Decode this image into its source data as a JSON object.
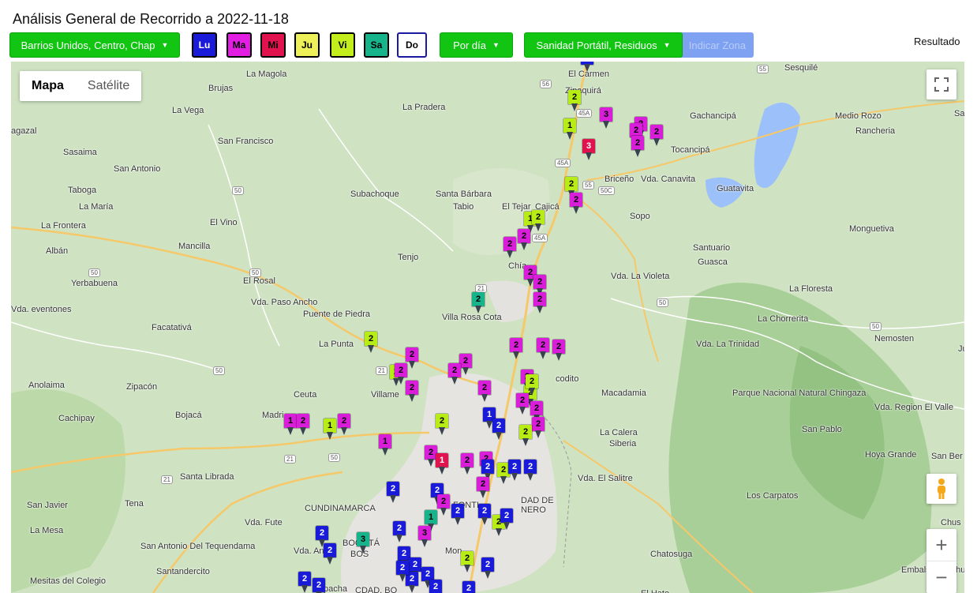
{
  "page_title": "Análisis General de Recorrido a 2022-11-18",
  "toolbar": {
    "barrios_select": "Barrios Unidos, Centro, Chap",
    "days": [
      {
        "label": "Lu",
        "color": "#1a1ad9"
      },
      {
        "label": "Ma",
        "color": "#e31ee3"
      },
      {
        "label": "Mi",
        "color": "#e0134f"
      },
      {
        "label": "Ju",
        "color": "#eef05a"
      },
      {
        "label": "Vi",
        "color": "#c3ee1b"
      },
      {
        "label": "Sa",
        "color": "#17b38a"
      },
      {
        "label": "Do",
        "color": "#ffffff"
      }
    ],
    "period_select": "Por día",
    "service_select": "Sanidad Portátil, Residuos",
    "indicar_zona": "Indicar Zona",
    "resultado": "Resultado"
  },
  "map": {
    "type_buttons": {
      "mapa": "Mapa",
      "satelite": "Satélite"
    },
    "fullscreen_icon": "fullscreen-icon",
    "pegman_icon": "pegman-icon",
    "zoom_in": "+",
    "zoom_out": "−",
    "marker_colors": {
      "lu": "#1a1ad9",
      "ma": "#d81ed8",
      "mi": "#e0134f",
      "ju": "#e8ef56",
      "vi": "#b7ec16",
      "sa": "#17b38a"
    },
    "places": [
      "La Magola",
      "Brujas",
      "El Carmen",
      "Zipaquirá",
      "Sesquilé",
      "La Pradera",
      "La Vega",
      "Gachancipá",
      "Medio Rozo",
      "Rancheria",
      "Sant",
      "agazal",
      "San Francisco",
      "Tocancipá",
      "Sasaima",
      "San Antonio",
      "Briceño",
      "Vda. Canavita",
      "Guatavita",
      "Taboga",
      "Subachoque",
      "Santa Bárbara",
      "Tabio",
      "El Tejar",
      "Cajicá",
      "La María",
      "Sopo",
      "La Frontera",
      "El Vino",
      "Monguetiva",
      "Mancilla",
      "Albán",
      "Santuario",
      "Guasca",
      "Tenjo",
      "Chía",
      "Yerbabuena",
      "El Rosal",
      "Vda. La Violeta",
      "La Floresta",
      "Vda. Paso Ancho",
      "Puente de Piedra",
      "Vda. eventones",
      "Villa Rosa Cota",
      "La Chorrerita",
      "Facatativá",
      "Nemosten",
      "Vda. La Trinidad",
      "Juni",
      "La Punta",
      "Anolaima",
      "Zipacón",
      "Villame",
      "codito",
      "Macadamia",
      "Parque Nacional Natural Chingaza",
      "Vda. Region El Valle",
      "Cachipay",
      "Bojacá",
      "Madri",
      "Ceuta",
      "San Pablo",
      "La Calera",
      "Siberia",
      "Hoya Grande",
      "San Ber",
      "Santa Librada",
      "Vda. El Salitre",
      "CUNDINAMARCA",
      "FONTI",
      "DAD DE",
      "NERO",
      "San Javier",
      "Tena",
      "Los Carpatos",
      "La Mesa",
      "Vda. Fute",
      "San Antonio Del Tequendama",
      "Vda. Anc",
      "BOGOTÁ",
      "BOS",
      "Mon",
      "Chatosuga",
      "Chus",
      "Santandercito",
      "Mesitas del Colegio",
      "pacha",
      "CDAD. BO",
      "Embalse de Chuz",
      "El Hato"
    ],
    "routes": [
      "56",
      "55",
      "45A",
      "45A",
      "55",
      "50C",
      "50",
      "50",
      "45A",
      "50",
      "21",
      "50",
      "50",
      "50",
      "21",
      "50",
      "21",
      "21"
    ],
    "markers": [
      {
        "n": "2",
        "c": "lu"
      },
      {
        "n": "2",
        "c": "vi"
      },
      {
        "n": "3",
        "c": "ma"
      },
      {
        "n": "2",
        "c": "ma"
      },
      {
        "n": "2",
        "c": "ma"
      },
      {
        "n": "2",
        "c": "ma"
      },
      {
        "n": "1",
        "c": "vi"
      },
      {
        "n": "3",
        "c": "mi"
      },
      {
        "n": "2",
        "c": "ma"
      },
      {
        "n": "2",
        "c": "vi"
      },
      {
        "n": "2",
        "c": "ma"
      },
      {
        "n": "1",
        "c": "vi"
      },
      {
        "n": "2",
        "c": "ma"
      },
      {
        "n": "2",
        "c": "vi"
      },
      {
        "n": "2",
        "c": "ma"
      },
      {
        "n": "2",
        "c": "ma"
      },
      {
        "n": "2",
        "c": "ma"
      },
      {
        "n": "2",
        "c": "ma"
      },
      {
        "n": "2",
        "c": "sa"
      },
      {
        "n": "2",
        "c": "vi"
      },
      {
        "n": "2",
        "c": "ma"
      },
      {
        "n": "2",
        "c": "ma"
      },
      {
        "n": "2",
        "c": "ma"
      },
      {
        "n": "2",
        "c": "ma"
      },
      {
        "n": "2",
        "c": "vi"
      },
      {
        "n": "2",
        "c": "ma"
      },
      {
        "n": "2",
        "c": "ma"
      },
      {
        "n": "2",
        "c": "ma"
      },
      {
        "n": "2",
        "c": "ma"
      },
      {
        "n": "2",
        "c": "vi"
      },
      {
        "n": "2",
        "c": "ma"
      },
      {
        "n": "2",
        "c": "vi"
      },
      {
        "n": "2",
        "c": "ma"
      },
      {
        "n": "2",
        "c": "ma"
      },
      {
        "n": "2",
        "c": "ma"
      },
      {
        "n": "2",
        "c": "ma"
      },
      {
        "n": "2",
        "c": "vi"
      },
      {
        "n": "1",
        "c": "ma"
      },
      {
        "n": "2",
        "c": "ma"
      },
      {
        "n": "1",
        "c": "vi"
      },
      {
        "n": "2",
        "c": "ma"
      },
      {
        "n": "1",
        "c": "lu"
      },
      {
        "n": "2",
        "c": "lu"
      },
      {
        "n": "2",
        "c": "vi"
      },
      {
        "n": "1",
        "c": "ma"
      },
      {
        "n": "2",
        "c": "ma"
      },
      {
        "n": "1",
        "c": "mi"
      },
      {
        "n": "2",
        "c": "ma"
      },
      {
        "n": "2",
        "c": "ma"
      },
      {
        "n": "2",
        "c": "lu"
      },
      {
        "n": "2",
        "c": "vi"
      },
      {
        "n": "2",
        "c": "lu"
      },
      {
        "n": "2",
        "c": "lu"
      },
      {
        "n": "2",
        "c": "ma"
      },
      {
        "n": "2",
        "c": "lu"
      },
      {
        "n": "2",
        "c": "lu"
      },
      {
        "n": "1",
        "c": "sa"
      },
      {
        "n": "2",
        "c": "ma"
      },
      {
        "n": "2",
        "c": "lu"
      },
      {
        "n": "2",
        "c": "lu"
      },
      {
        "n": "2",
        "c": "vi"
      },
      {
        "n": "2",
        "c": "lu"
      },
      {
        "n": "3",
        "c": "sa"
      },
      {
        "n": "2",
        "c": "lu"
      },
      {
        "n": "2",
        "c": "lu"
      },
      {
        "n": "2",
        "c": "lu"
      },
      {
        "n": "3",
        "c": "ma"
      },
      {
        "n": "2",
        "c": "lu"
      },
      {
        "n": "2",
        "c": "lu"
      },
      {
        "n": "2",
        "c": "lu"
      },
      {
        "n": "2",
        "c": "vi"
      },
      {
        "n": "2",
        "c": "lu"
      },
      {
        "n": "2",
        "c": "lu"
      },
      {
        "n": "2",
        "c": "lu"
      },
      {
        "n": "2",
        "c": "lu"
      },
      {
        "n": "2",
        "c": "lu"
      },
      {
        "n": "2",
        "c": "lu"
      },
      {
        "n": "2",
        "c": "lu"
      }
    ]
  }
}
